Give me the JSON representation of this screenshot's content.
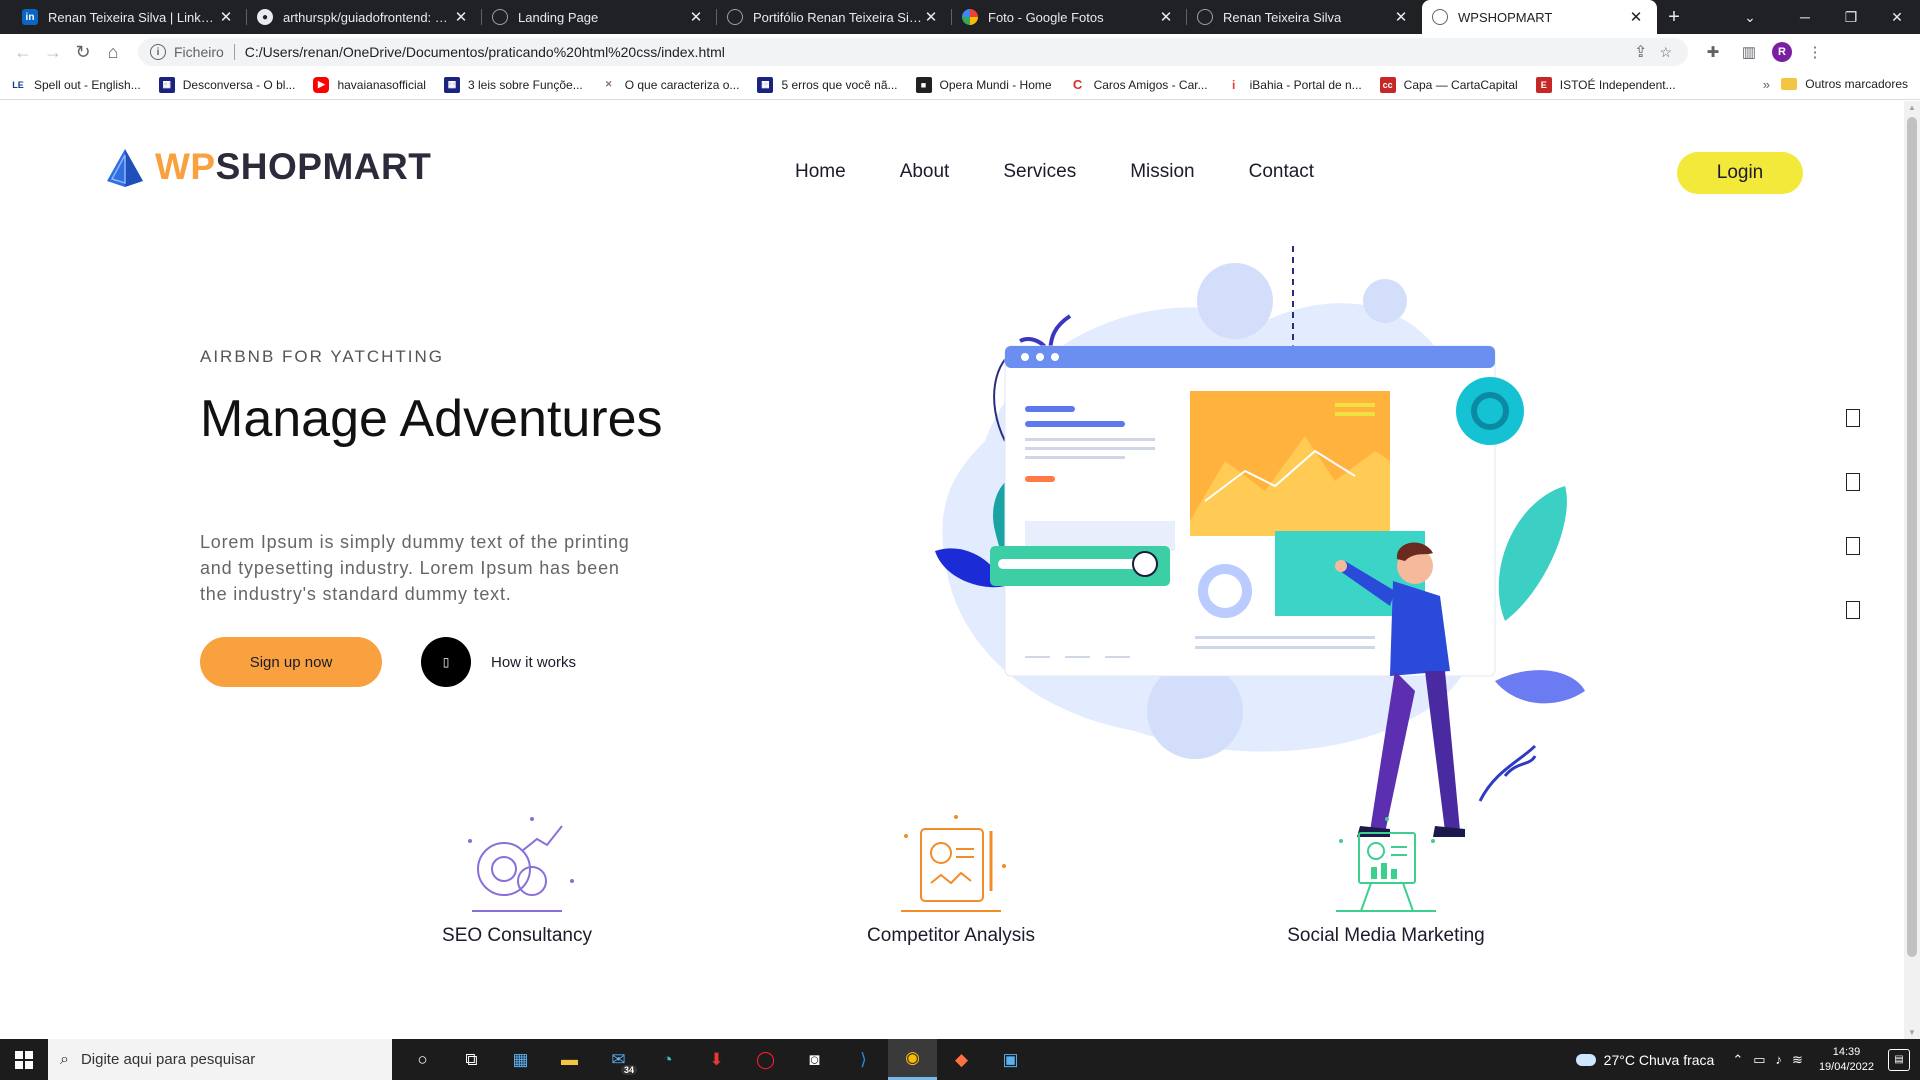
{
  "browser": {
    "tabs": [
      {
        "label": "Renan Teixeira Silva | LinkedIn",
        "icon": "linkedin-icon",
        "active": false
      },
      {
        "label": "arthurspk/guiadofrontend: Guia",
        "icon": "github-icon",
        "active": false
      },
      {
        "label": "Landing Page",
        "icon": "globe-icon",
        "active": false
      },
      {
        "label": "Portifólio Renan Teixeira Silva",
        "icon": "globe-icon",
        "active": false
      },
      {
        "label": "Foto - Google Fotos",
        "icon": "google-photos-icon",
        "active": false
      },
      {
        "label": "Renan Teixeira Silva",
        "icon": "globe-icon",
        "active": false
      },
      {
        "label": "WPSHOPMART",
        "icon": "globe-icon",
        "active": true
      }
    ],
    "address": {
      "scheme": "Ficheiro",
      "url": "C:/Users/renan/OneDrive/Documentos/praticando%20html%20css/index.html"
    },
    "profile_initial": "R",
    "bookmarks": [
      {
        "label": "Spell out - English...",
        "color": "#0a3d91",
        "glyph": "LE"
      },
      {
        "label": "Desconversa - O bl...",
        "color": "#1a237e",
        "glyph": "▦"
      },
      {
        "label": "havaianasofficial",
        "color": "#ff0000",
        "glyph": "▶"
      },
      {
        "label": "3 leis sobre Funçõe...",
        "color": "#1a237e",
        "glyph": "▦"
      },
      {
        "label": "O que caracteriza o...",
        "color": "#8d6e63",
        "glyph": "✕"
      },
      {
        "label": "5 erros que você nã...",
        "color": "#1a237e",
        "glyph": "▦"
      },
      {
        "label": "Opera Mundi - Home",
        "color": "#212121",
        "glyph": "■"
      },
      {
        "label": "Caros Amigos - Car...",
        "color": "#d32f2f",
        "glyph": "C"
      },
      {
        "label": "iBahia - Portal de n...",
        "color": "#e53935",
        "glyph": "i"
      },
      {
        "label": "Capa — CartaCapital",
        "color": "#c62828",
        "glyph": "cc"
      },
      {
        "label": "ISTOÉ Independent...",
        "color": "#c62828",
        "glyph": "E"
      }
    ],
    "bookmarks_more": "»",
    "bookmarks_other": "Outros marcadores"
  },
  "site": {
    "logo": {
      "wp": "WP",
      "rest": "SHOPMART"
    },
    "nav": [
      "Home",
      "About",
      "Services",
      "Mission",
      "Contact"
    ],
    "login_label": "Login",
    "hero": {
      "eyebrow": "AIRBNB FOR YATCHTING",
      "headline": "Manage Adventures",
      "lead": "Lorem Ipsum is simply dummy text of the printing and typesetting industry. Lorem Ipsum has been the industry's standard dummy text.",
      "signup_label": "Sign up now",
      "how_label": "How it works"
    },
    "services": [
      {
        "title": "SEO Consultancy",
        "icon": "seo-gears-icon",
        "color": "#8a6fd9"
      },
      {
        "title": "Competitor Analysis",
        "icon": "analysis-board-icon",
        "color": "#f28c28"
      },
      {
        "title": "Social Media Marketing",
        "icon": "presentation-icon",
        "color": "#3ccf8e"
      }
    ],
    "social_icons": [
      "social-icon-1",
      "social-icon-2",
      "social-icon-3",
      "social-icon-4"
    ]
  },
  "taskbar": {
    "search_placeholder": "Digite aqui para pesquisar",
    "mail_badge": "34",
    "weather": "27°C  Chuva fraca",
    "time": "14:39",
    "date": "19/04/2022"
  }
}
